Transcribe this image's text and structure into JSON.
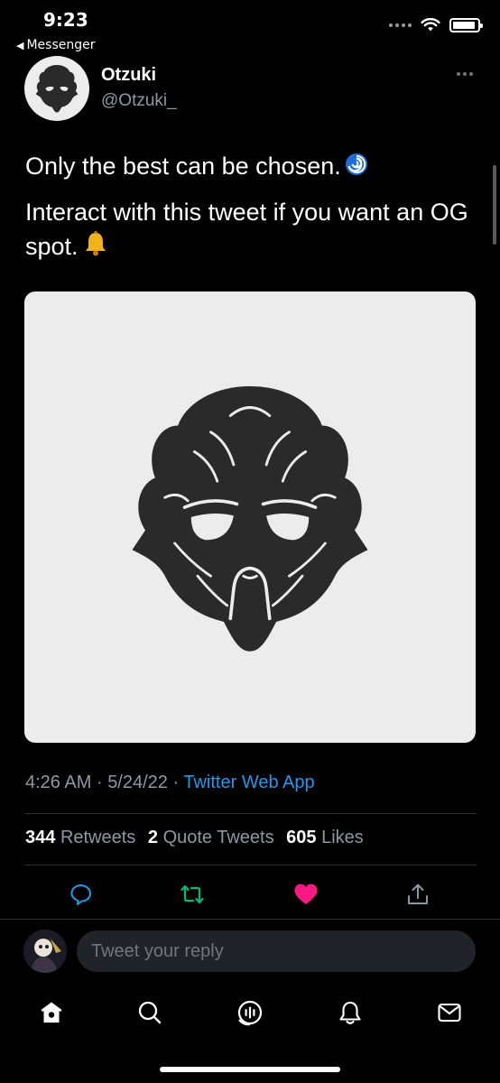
{
  "status_bar": {
    "time": "9:23",
    "back_app": "Messenger"
  },
  "author": {
    "name": "Otzuki",
    "handle": "@Otzuki_"
  },
  "tweet": {
    "line1": "Only the best can be chosen.",
    "line2": "Interact with this tweet if you want an OG spot.",
    "emoji1": "cyclone-emoji",
    "emoji2": "bell-emoji"
  },
  "meta": {
    "time": "4:26 AM",
    "sep1": "·",
    "date": "5/24/22",
    "sep2": "·",
    "source": "Twitter Web App"
  },
  "stats": {
    "retweets_count": "344",
    "retweets_label": "Retweets",
    "quotes_count": "2",
    "quotes_label": "Quote Tweets",
    "likes_count": "605",
    "likes_label": "Likes"
  },
  "actions": [
    "reply-icon",
    "retweet-icon",
    "like-icon",
    "share-icon"
  ],
  "reply": {
    "placeholder": "Tweet your reply"
  },
  "nav": [
    "home-icon",
    "search-icon",
    "spaces-icon",
    "notifications-icon",
    "messages-icon"
  ],
  "colors": {
    "accent": "#1d9bf0",
    "retweet": "#00ba7c",
    "like": "#f91880",
    "background": "#000000"
  }
}
